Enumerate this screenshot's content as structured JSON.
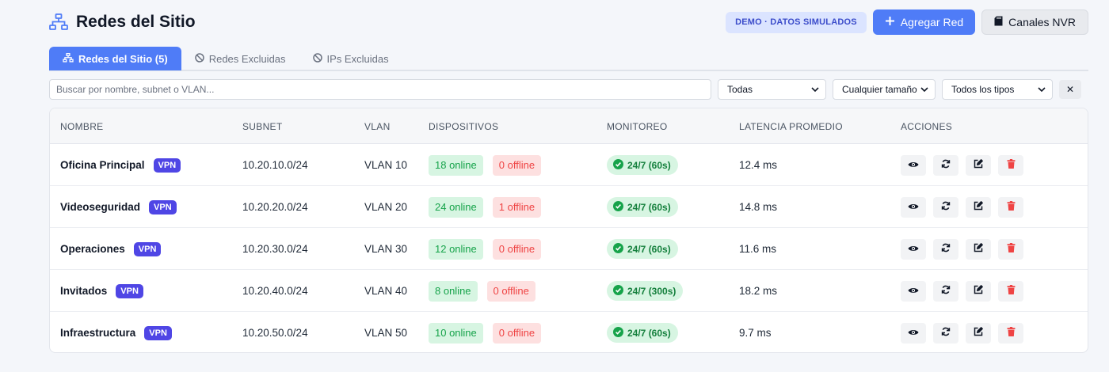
{
  "header": {
    "title": "Redes del Sitio",
    "demo_badge": "DEMO · DATOS SIMULADOS",
    "add_button": "Agregar Red",
    "nvr_button": "Canales NVR"
  },
  "tabs": [
    {
      "label": "Redes del Sitio (5)",
      "active": true
    },
    {
      "label": "Redes Excluidas",
      "active": false
    },
    {
      "label": "IPs Excluidas",
      "active": false
    }
  ],
  "filters": {
    "search_placeholder": "Buscar por nombre, subnet o VLAN...",
    "select_1": "Todas",
    "select_2": "Cualquier tamaño",
    "select_3": "Todos los tipos",
    "clear": "✕"
  },
  "table": {
    "columns": [
      "NOMBRE",
      "SUBNET",
      "VLAN",
      "DISPOSITIVOS",
      "MONITOREO",
      "LATENCIA PROMEDIO",
      "ACCIONES"
    ],
    "rows": [
      {
        "name": "Oficina Principal",
        "badge": "VPN",
        "subnet": "10.20.10.0/24",
        "vlan": "VLAN 10",
        "online": "18 online",
        "offline": "0 offline",
        "monitor": "24/7 (60s)",
        "latency": "12.4 ms"
      },
      {
        "name": "Videoseguridad",
        "badge": "VPN",
        "subnet": "10.20.20.0/24",
        "vlan": "VLAN 20",
        "online": "24 online",
        "offline": "1 offline",
        "monitor": "24/7 (60s)",
        "latency": "14.8 ms"
      },
      {
        "name": "Operaciones",
        "badge": "VPN",
        "subnet": "10.20.30.0/24",
        "vlan": "VLAN 30",
        "online": "12 online",
        "offline": "0 offline",
        "monitor": "24/7 (60s)",
        "latency": "11.6 ms"
      },
      {
        "name": "Invitados",
        "badge": "VPN",
        "subnet": "10.20.40.0/24",
        "vlan": "VLAN 40",
        "online": "8 online",
        "offline": "0 offline",
        "monitor": "24/7 (300s)",
        "latency": "18.2 ms"
      },
      {
        "name": "Infraestructura",
        "badge": "VPN",
        "subnet": "10.20.50.0/24",
        "vlan": "VLAN 50",
        "online": "10 online",
        "offline": "0 offline",
        "monitor": "24/7 (60s)",
        "latency": "9.7 ms"
      }
    ]
  },
  "icons": {
    "title": "sitemap-icon",
    "add": "plus-icon",
    "nvr": "sd-card-icon",
    "tab_1": "sitemap-icon",
    "tab_2": "ban-icon",
    "tab_3": "ban-icon",
    "monitor": "check-circle-icon",
    "actions": [
      "eye-icon",
      "sync-icon",
      "edit-icon",
      "trash-icon"
    ]
  },
  "colors": {
    "primary": "#4f7cf7",
    "vpn_badge": "#4f46e5",
    "online_bg": "#d7f5e2",
    "online_text": "#16a34a",
    "offline_bg": "#fde0e0",
    "offline_text": "#ef4444",
    "delete": "#ef4444"
  }
}
